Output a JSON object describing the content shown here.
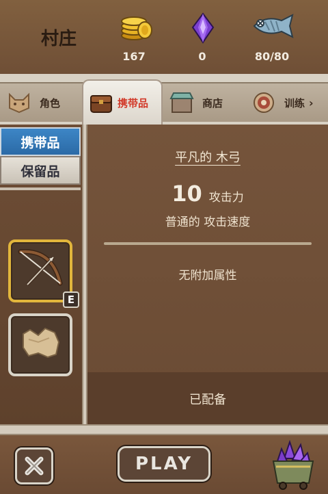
{
  "header": {
    "location": "村庄",
    "resources": [
      {
        "name": "gold",
        "icon": "gold-coins-icon",
        "value": "167"
      },
      {
        "name": "gems",
        "icon": "purple-gem-icon",
        "value": "0"
      },
      {
        "name": "food",
        "icon": "fish-icon",
        "value": "80/80"
      }
    ]
  },
  "tabs": [
    {
      "label": "角色",
      "icon": "cat-face-icon"
    },
    {
      "label": "携带品",
      "icon": "backpack-icon",
      "active": true
    },
    {
      "label": "商店",
      "icon": "shop-stall-icon"
    },
    {
      "label": "训练",
      "icon": "target-icon"
    }
  ],
  "tabs_more": "›",
  "inventory": {
    "tabs": [
      "携带品",
      "保留品"
    ],
    "slots": [
      {
        "item": "bow-icon",
        "badge": "E"
      },
      {
        "item": "parchment-icon"
      }
    ]
  },
  "detail": {
    "item_name": "平凡的 木弓",
    "attack_value": "10",
    "attack_label": "攻击力",
    "speed_label": "普通的 攻击速度",
    "no_attributes": "无附加属性",
    "equipped": "已配备"
  },
  "bottom": {
    "play_label": "PLAY"
  },
  "colors": {
    "accent_active_tab": "#d23a2a",
    "side_tab_active": "#3d86c6",
    "equipped_border": "#e2b63c"
  }
}
